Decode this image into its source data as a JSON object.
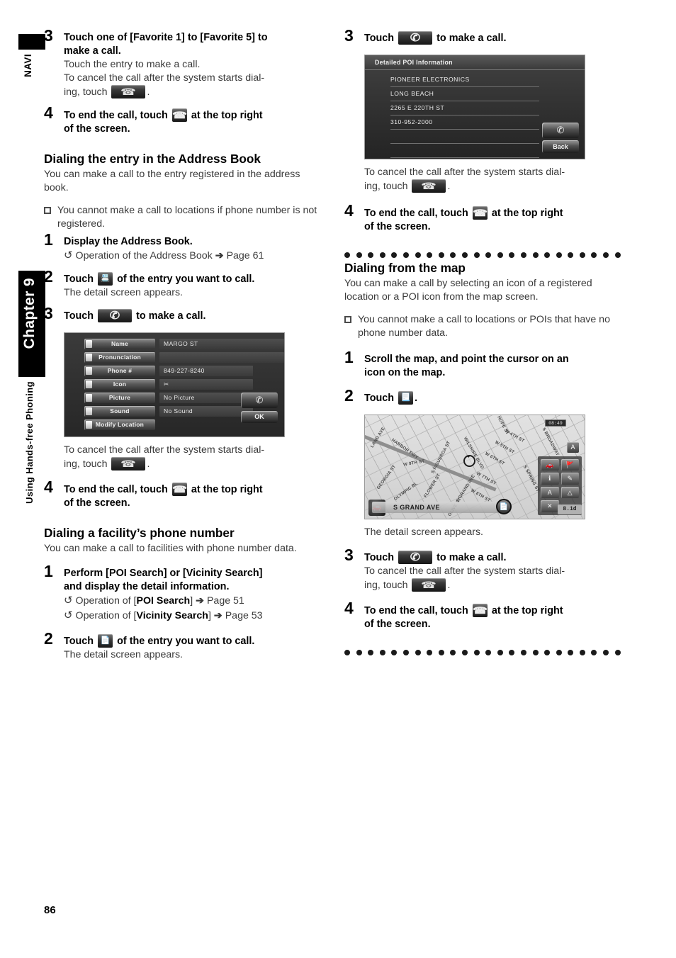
{
  "sidebar": {
    "navi_label": "NAVI",
    "chapter_label": "Chapter 9",
    "section_label": "Using Hands-free Phoning"
  },
  "page_number": "86",
  "left_column": {
    "step3": {
      "num": "3",
      "title_line1": "Touch one of [Favorite 1] to [Favorite 5] to",
      "title_line2": "make a call.",
      "sub1": "Touch the entry to make a call.",
      "sub2_pre": "To cancel the call after the system starts dial-",
      "sub2_post": "ing, touch",
      "sub2_end": ".",
      "icon": "hangup-button-icon"
    },
    "step4": {
      "num": "4",
      "title_pre": "To end the call, touch",
      "title_post": "at the top right",
      "title_line2": "of the screen.",
      "icon": "end-call-button-icon"
    },
    "heading_address_book": "Dialing the entry in the Address Book",
    "para_address_book": "You can make a call to the entry registered in the address book.",
    "note_address_book": "You cannot make a call to locations if phone number is not registered.",
    "step1": {
      "num": "1",
      "title": "Display the Address Book.",
      "ref": "Operation of the Address Book",
      "ref_arrow": "➔",
      "ref_page": "Page 61"
    },
    "step2": {
      "num": "2",
      "title_pre": "Touch",
      "title_post": "of the entry you want to call.",
      "sub": "The detail screen appears.",
      "icon": "address-entry-button-icon"
    },
    "step3b": {
      "num": "3",
      "title_pre": "Touch",
      "title_post": "to make a call.",
      "icon": "call-button-icon",
      "sub_pre": "To cancel the call after the system starts dial-",
      "sub_post": "ing, touch",
      "sub_end": "."
    },
    "step4b": {
      "num": "4",
      "title_pre": "To end the call, touch",
      "title_post": "at the top right",
      "title_line2": "of the screen."
    },
    "heading_facility": "Dialing a facility’s phone number",
    "para_facility": "You can make a call to facilities with phone number data.",
    "step1b": {
      "num": "1",
      "title_line1": "Perform [POI Search] or [Vicinity Search]",
      "title_line2": "and display the detail information.",
      "ref1_pre": "Operation of [",
      "ref1_bold": "POI Search",
      "ref1_post": "]",
      "ref1_arrow": "➔",
      "ref1_page": "Page 51",
      "ref2_pre": "Operation of [",
      "ref2_bold": "Vicinity Search",
      "ref2_post": "]",
      "ref2_arrow": "➔",
      "ref2_page": "Page 53"
    },
    "step2b": {
      "num": "2",
      "title_pre": "Touch",
      "title_post": "of the entry you want to call.",
      "sub": "The detail screen appears.",
      "icon": "poi-entry-button-icon"
    }
  },
  "address_book_screen": {
    "rows": [
      {
        "key": "Name",
        "value": "MARGO ST"
      },
      {
        "key": "Pronunciation",
        "value": ""
      },
      {
        "key": "Phone #",
        "value": "849-227-8240"
      },
      {
        "key": "Icon",
        "value": "✂"
      },
      {
        "key": "Picture",
        "value": "No Picture"
      },
      {
        "key": "Sound",
        "value": "No Sound"
      },
      {
        "key": "Modify Location",
        "value": ""
      }
    ],
    "call_button": "✆",
    "ok_button": "OK"
  },
  "right_column": {
    "step3": {
      "num": "3",
      "title_pre": "Touch",
      "title_post": "to make a call.",
      "icon": "call-button-icon",
      "sub_pre": "To cancel the call after the system starts dial-",
      "sub_post": "ing, touch",
      "sub_end": "."
    },
    "step4": {
      "num": "4",
      "title_pre": "To end the call, touch",
      "title_post": "at the top right",
      "title_line2": "of the screen."
    },
    "heading_map": "Dialing from the map",
    "para_map": "You can make a call by selecting an icon of a registered location or a POI icon from the map screen.",
    "note_map": "You cannot make a call to locations or POIs that have no phone number data.",
    "step1": {
      "num": "1",
      "title_line1": "Scroll the map, and point the cursor on an",
      "title_line2": "icon on the map."
    },
    "step2": {
      "num": "2",
      "title_pre": "Touch",
      "title_end": ".",
      "icon": "map-detail-button-icon",
      "sub": "The detail screen appears."
    },
    "step3b": {
      "num": "3",
      "title_pre": "Touch",
      "title_post": "to make a call.",
      "sub_pre": "To cancel the call after the system starts dial-",
      "sub_post": "ing, touch",
      "sub_end": "."
    },
    "step4b": {
      "num": "4",
      "title_pre": "To end the call, touch",
      "title_post": "at the top right",
      "title_line2": "of the screen."
    }
  },
  "poi_screen": {
    "title": "Detailed POI Information",
    "fields": [
      "PIONEER ELECTRONICS",
      "LONG BEACH",
      "2265 E 220TH ST",
      "310-952-2000",
      "",
      ""
    ],
    "call_button": "✆",
    "back_button": "Back"
  },
  "map_screen": {
    "clock": "08:49",
    "scale": "8.1d",
    "north_icon": "A",
    "street_bar": "S GRAND AVE",
    "street_labels": [
      "LAND AVE",
      "HARBOR FWY",
      "S FIGUEROA ST",
      "FLOWER ST",
      "WILSHIRE BLVD",
      "S GRAND AVE",
      "OLIVE ST",
      "S HOPE ST",
      "S SPRING ST",
      "S BROADWAY",
      "GEORGIA ST",
      "OLYMPIC BL",
      "W 4TH ST",
      "W 5TH ST",
      "W 6TH ST",
      "W 7TH ST",
      "W 8TH ST",
      "W 9TH ST"
    ],
    "panel_icons": [
      "route-icon",
      "destination-icon",
      "info-icon",
      "tool-icon",
      "abc-icon",
      "edit-icon",
      "close-icon"
    ]
  },
  "dot_rule_count": 24
}
